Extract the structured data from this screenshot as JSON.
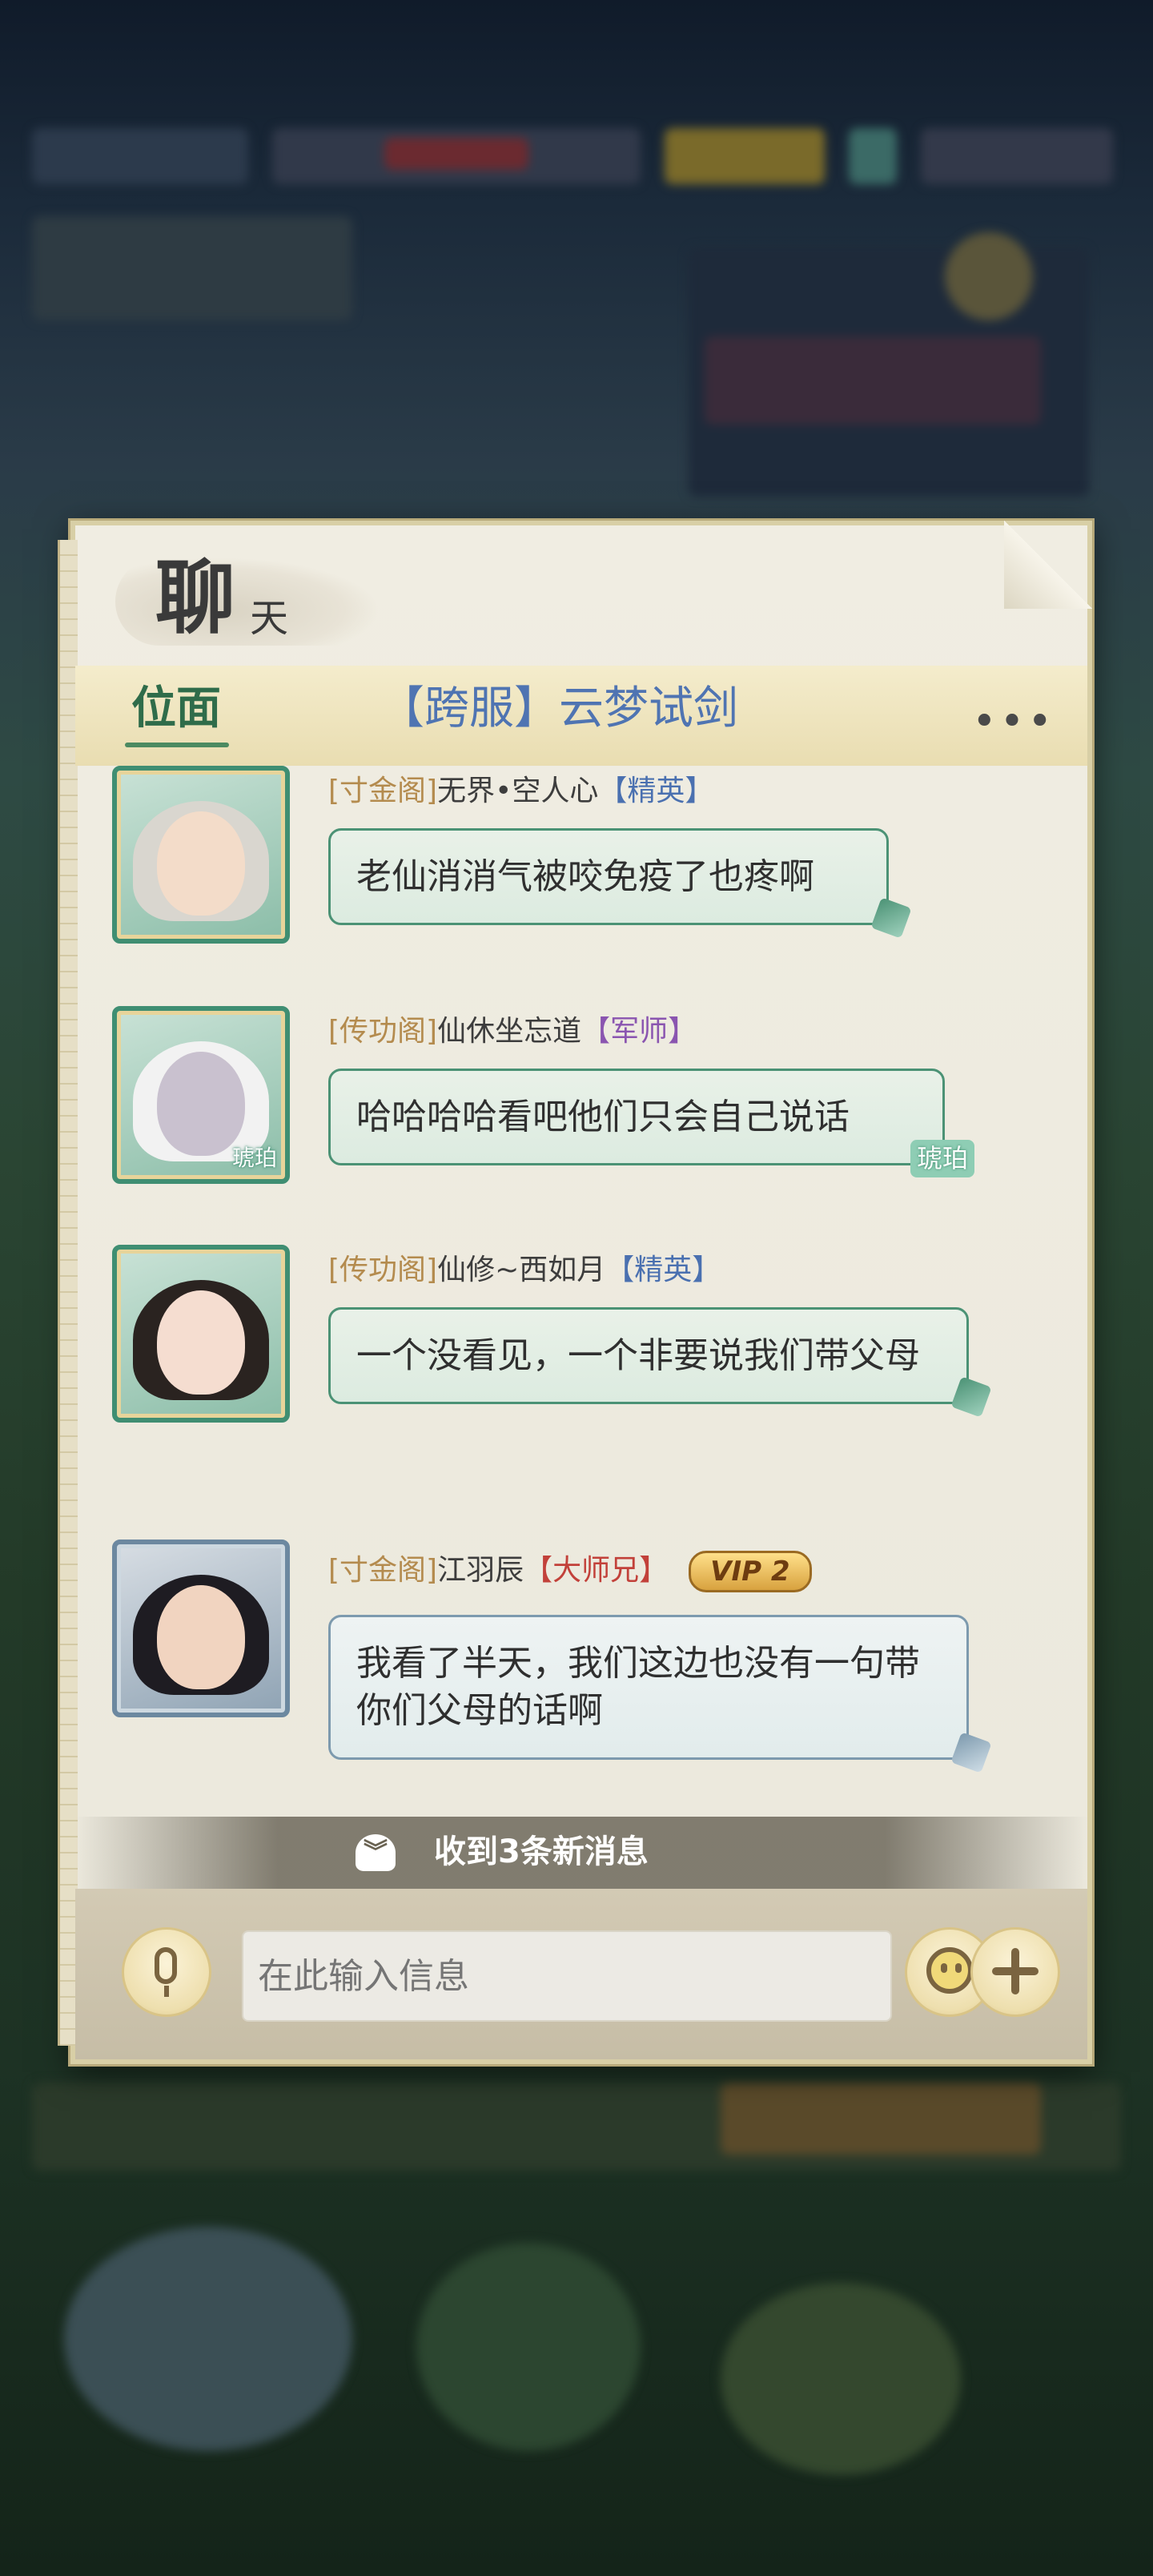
{
  "panel": {
    "title_main": "聊",
    "title_sub": "天",
    "more_label": "•••"
  },
  "tabs": [
    {
      "label": "位面"
    },
    {
      "label": "【跨服】云梦试剑"
    }
  ],
  "messages": [
    {
      "guild": "[寸金阁]",
      "name": "无界•空人心",
      "role": "【精英】",
      "text": "老仙消消气被咬免疫了也疼啊"
    },
    {
      "guild": "[传功阁]",
      "name": "仙休坐忘道",
      "role": "【军师】",
      "text": "哈哈哈哈看吧他们只会自己说话",
      "avatar_tag": "琥珀",
      "bubble_tag": "琥珀"
    },
    {
      "guild": "[传功阁]",
      "name": "仙修~西如月",
      "role": "【精英】",
      "text": "一个没看见，一个非要说我们带父母"
    },
    {
      "guild": "[寸金阁]",
      "name": "江羽辰",
      "role": "【大师兄】",
      "vip": "VIP 2",
      "text": "我看了半天，我们这边也没有一句带你们父母的话啊"
    }
  ],
  "new_messages": {
    "text": "收到3条新消息"
  },
  "input": {
    "placeholder": "在此输入信息"
  },
  "colors": {
    "accent_green": "#2f6c4a",
    "tab_blue": "#4f74b2",
    "role_blue": "#4a70b0",
    "role_purple": "#8a55b0",
    "role_red": "#c2413a",
    "guild_gold": "#b48b4e"
  }
}
